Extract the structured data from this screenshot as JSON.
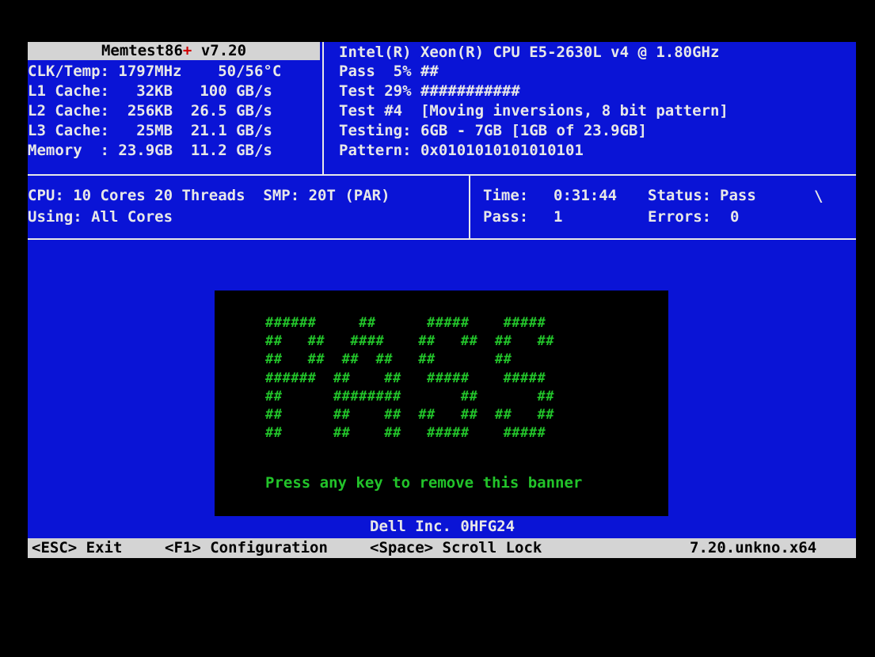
{
  "sysinfo": {
    "title_name": "Memtest86",
    "title_plus": "+",
    "title_version": " v7.20",
    "rows": [
      "CLK/Temp: 1797MHz    50/56°C",
      "L1 Cache:   32KB   100 GB/s",
      "L2 Cache:  256KB  26.5 GB/s",
      "L3 Cache:   25MB  21.1 GB/s",
      "Memory  : 23.9GB  11.2 GB/s"
    ]
  },
  "progress": {
    "cpu_name": "Intel(R) Xeon(R) CPU E5-2630L v4 @ 1.80GHz",
    "pass_line": "Pass  5% ##",
    "pass_percent": 5,
    "test_line": "Test 29% ###########",
    "test_percent": 29,
    "test_name": "Test #4  [Moving inversions, 8 bit pattern]",
    "testing": "Testing: 6GB - 7GB [1GB of 23.9GB]",
    "pattern": "Pattern: 0x0101010101010101"
  },
  "cpu": {
    "line1": "CPU: 10 Cores 20 Threads  SMP: 20T (PAR)",
    "line2": "Using: All Cores"
  },
  "stats": {
    "time_label": "Time:",
    "time_value": "0:31:44",
    "status_label": "Status:",
    "status_value": "Pass",
    "pass_label": "Pass:",
    "pass_value": "1",
    "errors_label": "Errors:",
    "errors_value": "0",
    "spinner": "\\"
  },
  "banner": {
    "ascii_art": "######     ##      #####    #####\n##   ##   ####    ##   ##  ##   ##\n##   ##  ##  ##   ##       ##\n######  ##    ##   #####    #####\n##      ########       ##       ##\n##      ##    ##  ##   ##  ##   ##\n##      ##    ##   #####    #####",
    "message": "Press any key to remove this banner"
  },
  "system_board": "Dell Inc. 0HFG24",
  "footer": {
    "esc": "<ESC> Exit",
    "f1": "<F1> Configuration",
    "space": "<Space> Scroll Lock",
    "build": "7.20.unkno.x64"
  },
  "colors": {
    "background": "#0a14d6",
    "text": "#e8e8e8",
    "banner_text": "#22c42a",
    "bar": "#d4d4d4",
    "accent_plus": "#d00000"
  }
}
